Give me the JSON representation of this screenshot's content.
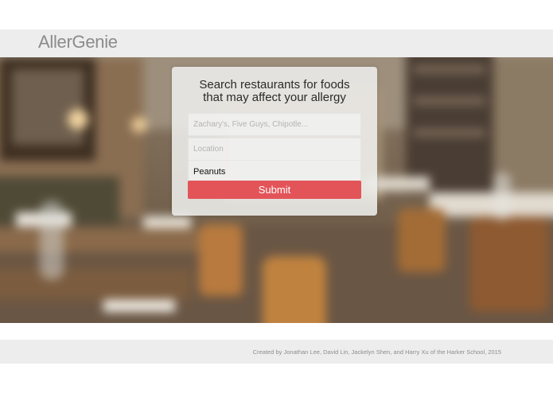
{
  "header": {
    "logo": "AllerGenie"
  },
  "search_card": {
    "title_line1": "Search restaurants for foods",
    "title_line2": "that may affect your allergy",
    "restaurant_placeholder": "Zachary's, Five Guys, Chipotle...",
    "location_placeholder": "Location",
    "allergy_value": "Peanuts",
    "submit_label": "Submit"
  },
  "footer": {
    "credits": "Created by Jonathan Lee, David Lin, Jackelyn Shen, and Harry Xu of the Harker School, 2015"
  },
  "colors": {
    "accent": "#e35459",
    "band": "#ededed",
    "logo": "#8b8b8b"
  }
}
